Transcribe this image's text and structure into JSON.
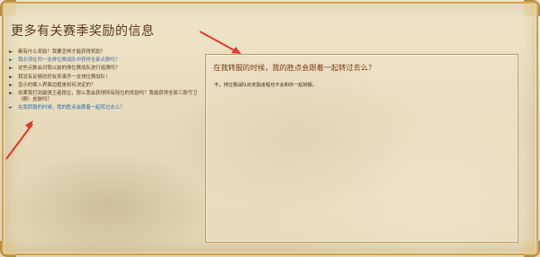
{
  "page": {
    "title": "更多有关赛季奖励的信息"
  },
  "faq": {
    "items": [
      {
        "text": "都有什么奖励？我要怎样才能获得奖励？",
        "style": "normal"
      },
      {
        "text": "我必须在同一支排位赛战队中获得全部点数吗？",
        "style": "link"
      },
      {
        "text": "这些点数会对我以前的排位赛战队进行追溯吗？",
        "style": "normal"
      },
      {
        "text": "我没有足够的好友来凑齐一支排位赛战队！",
        "style": "normal"
      },
      {
        "text": "显示的载入界面边框是如何决定的？",
        "style": "normal"
      },
      {
        "text": "如果我打到最强王者段位，那么我会获得所有段位的奖励吗？我能获得全部三款守卫（眼）皮肤吗？",
        "style": "normal"
      },
      {
        "text": "在我转服的时候，我的胜点会跟着一起转过去么？",
        "style": "active"
      }
    ]
  },
  "answer": {
    "title": "在我转服的时候，我的胜点会跟着一起转过去么？",
    "text": "不，排位赛战队的奖励进程也不会和你一起转服。"
  },
  "colors": {
    "annotation_arrow": "#e03a2c",
    "link": "#2f6fb0"
  }
}
